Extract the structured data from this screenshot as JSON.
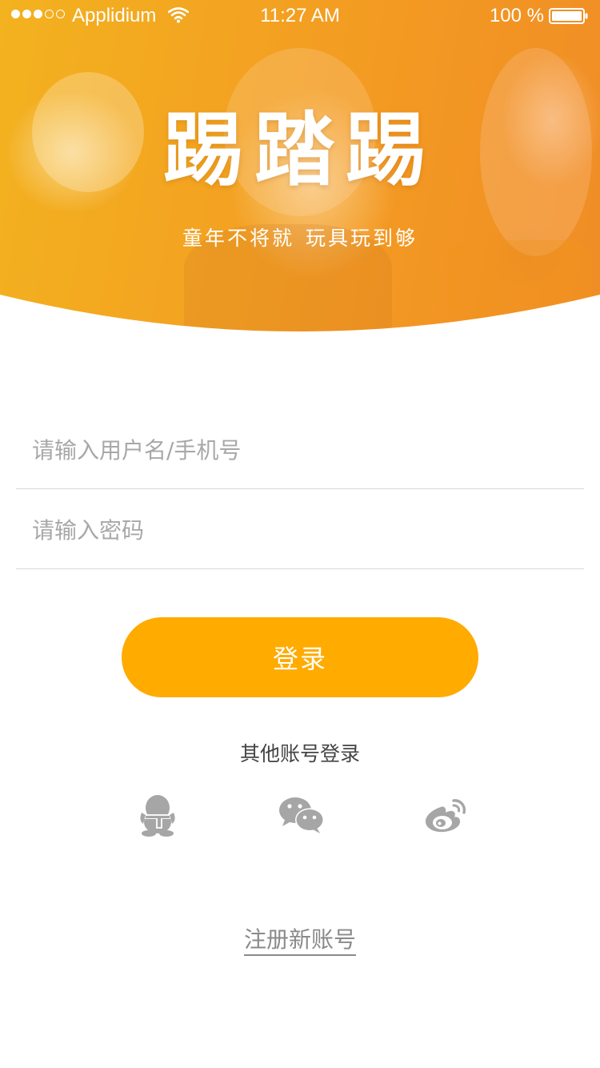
{
  "status_bar": {
    "carrier": "Applidium",
    "time": "11:27 AM",
    "battery": "100 %",
    "signal_icon": "signal-dots-icon",
    "wifi_icon": "wifi-icon",
    "battery_icon": "battery-icon"
  },
  "hero": {
    "logo_text": "踢踏踢",
    "slogan_left": "童年不将就",
    "slogan_right": "玩具玩到够",
    "colors": {
      "primary": "#f3a421",
      "accent": "#ffab00"
    }
  },
  "form": {
    "username_placeholder": "请输入用户名/手机号",
    "password_placeholder": "请输入密码",
    "login_label": "登录"
  },
  "social_login": {
    "label": "其他账号登录",
    "providers": [
      {
        "name": "qq",
        "icon": "qq-icon"
      },
      {
        "name": "wechat",
        "icon": "wechat-icon"
      },
      {
        "name": "weibo",
        "icon": "weibo-icon"
      }
    ]
  },
  "register": {
    "link_label": "注册新账号"
  }
}
